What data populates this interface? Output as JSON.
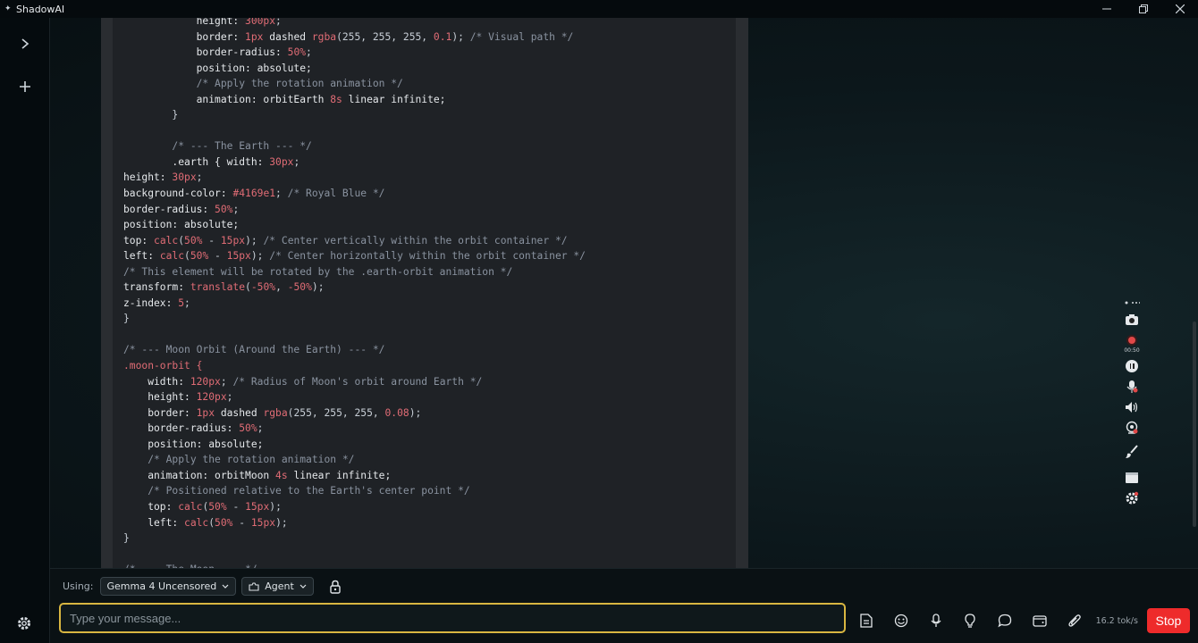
{
  "window": {
    "title": "ShadowAI"
  },
  "code_lines": [
    [
      {
        "t": "            height: ",
        "c": "k"
      },
      {
        "t": "300px",
        "c": "n"
      },
      {
        "t": ";",
        "c": "p"
      }
    ],
    [
      {
        "t": "            border: ",
        "c": "k"
      },
      {
        "t": "1px",
        "c": "n"
      },
      {
        "t": " dashed ",
        "c": "k"
      },
      {
        "t": "rgba",
        "c": "n"
      },
      {
        "t": "(255, 255, 255, ",
        "c": "p"
      },
      {
        "t": "0.1",
        "c": "n"
      },
      {
        "t": "); ",
        "c": "p"
      },
      {
        "t": "/* Visual path */",
        "c": "c"
      }
    ],
    [
      {
        "t": "            border-radius: ",
        "c": "k"
      },
      {
        "t": "50%",
        "c": "n"
      },
      {
        "t": ";",
        "c": "p"
      }
    ],
    [
      {
        "t": "            position: absolute;",
        "c": "k"
      }
    ],
    [
      {
        "t": "            /* Apply the rotation animation */",
        "c": "c"
      }
    ],
    [
      {
        "t": "            animation: orbitEarth ",
        "c": "k"
      },
      {
        "t": "8s",
        "c": "n"
      },
      {
        "t": " linear infinite;",
        "c": "k"
      }
    ],
    [
      {
        "t": "        }",
        "c": "p"
      }
    ],
    [
      {
        "t": "",
        "c": "p"
      }
    ],
    [
      {
        "t": "        /* --- The Earth --- */",
        "c": "c"
      }
    ],
    [
      {
        "t": "        .earth { width: ",
        "c": "k"
      },
      {
        "t": "30px",
        "c": "n"
      },
      {
        "t": ";",
        "c": "p"
      }
    ],
    [
      {
        "t": "height: ",
        "c": "k"
      },
      {
        "t": "30px",
        "c": "n"
      },
      {
        "t": ";",
        "c": "p"
      }
    ],
    [
      {
        "t": "background-color: ",
        "c": "k"
      },
      {
        "t": "#4169e1",
        "c": "n"
      },
      {
        "t": "; ",
        "c": "p"
      },
      {
        "t": "/* Royal Blue */",
        "c": "c"
      }
    ],
    [
      {
        "t": "border-radius: ",
        "c": "k"
      },
      {
        "t": "50%",
        "c": "n"
      },
      {
        "t": ";",
        "c": "p"
      }
    ],
    [
      {
        "t": "position: absolute;",
        "c": "k"
      }
    ],
    [
      {
        "t": "top: ",
        "c": "k"
      },
      {
        "t": "calc",
        "c": "n"
      },
      {
        "t": "(",
        "c": "p"
      },
      {
        "t": "50%",
        "c": "n"
      },
      {
        "t": " - ",
        "c": "p"
      },
      {
        "t": "15px",
        "c": "n"
      },
      {
        "t": "); ",
        "c": "p"
      },
      {
        "t": "/* Center vertically within the orbit container */",
        "c": "c"
      }
    ],
    [
      {
        "t": "left: ",
        "c": "k"
      },
      {
        "t": "calc",
        "c": "n"
      },
      {
        "t": "(",
        "c": "p"
      },
      {
        "t": "50%",
        "c": "n"
      },
      {
        "t": " - ",
        "c": "p"
      },
      {
        "t": "15px",
        "c": "n"
      },
      {
        "t": "); ",
        "c": "p"
      },
      {
        "t": "/* Center horizontally within the orbit container */",
        "c": "c"
      }
    ],
    [
      {
        "t": "/* This element will be rotated by the .earth-orbit animation */",
        "c": "c"
      }
    ],
    [
      {
        "t": "transform: ",
        "c": "k"
      },
      {
        "t": "translate",
        "c": "n"
      },
      {
        "t": "(",
        "c": "p"
      },
      {
        "t": "-50%",
        "c": "n"
      },
      {
        "t": ", ",
        "c": "p"
      },
      {
        "t": "-50%",
        "c": "n"
      },
      {
        "t": ");",
        "c": "p"
      }
    ],
    [
      {
        "t": "z-index: ",
        "c": "k"
      },
      {
        "t": "5",
        "c": "n"
      },
      {
        "t": ";",
        "c": "p"
      }
    ],
    [
      {
        "t": "}",
        "c": "p"
      }
    ],
    [
      {
        "t": "",
        "c": "p"
      }
    ],
    [
      {
        "t": "/* --- Moon Orbit (Around the Earth) --- */",
        "c": "c"
      }
    ],
    [
      {
        "t": ".moon-orbit {",
        "c": "n"
      }
    ],
    [
      {
        "t": "    width: ",
        "c": "k"
      },
      {
        "t": "120px",
        "c": "n"
      },
      {
        "t": "; ",
        "c": "p"
      },
      {
        "t": "/* Radius of Moon's orbit around Earth */",
        "c": "c"
      }
    ],
    [
      {
        "t": "    height: ",
        "c": "k"
      },
      {
        "t": "120px",
        "c": "n"
      },
      {
        "t": ";",
        "c": "p"
      }
    ],
    [
      {
        "t": "    border: ",
        "c": "k"
      },
      {
        "t": "1px",
        "c": "n"
      },
      {
        "t": " dashed ",
        "c": "k"
      },
      {
        "t": "rgba",
        "c": "n"
      },
      {
        "t": "(255, 255, 255, ",
        "c": "p"
      },
      {
        "t": "0.08",
        "c": "n"
      },
      {
        "t": ");",
        "c": "p"
      }
    ],
    [
      {
        "t": "    border-radius: ",
        "c": "k"
      },
      {
        "t": "50%",
        "c": "n"
      },
      {
        "t": ";",
        "c": "p"
      }
    ],
    [
      {
        "t": "    position: absolute;",
        "c": "k"
      }
    ],
    [
      {
        "t": "    /* Apply the rotation animation */",
        "c": "c"
      }
    ],
    [
      {
        "t": "    animation: orbitMoon ",
        "c": "k"
      },
      {
        "t": "4s",
        "c": "n"
      },
      {
        "t": " linear infinite;",
        "c": "k"
      }
    ],
    [
      {
        "t": "    /* Positioned relative to the Earth's center point */",
        "c": "c"
      }
    ],
    [
      {
        "t": "    top: ",
        "c": "k"
      },
      {
        "t": "calc",
        "c": "n"
      },
      {
        "t": "(",
        "c": "p"
      },
      {
        "t": "50%",
        "c": "n"
      },
      {
        "t": " - ",
        "c": "p"
      },
      {
        "t": "15px",
        "c": "n"
      },
      {
        "t": ");",
        "c": "p"
      }
    ],
    [
      {
        "t": "    left: ",
        "c": "k"
      },
      {
        "t": "calc",
        "c": "n"
      },
      {
        "t": "(",
        "c": "p"
      },
      {
        "t": "50%",
        "c": "n"
      },
      {
        "t": " - ",
        "c": "p"
      },
      {
        "t": "15px",
        "c": "n"
      },
      {
        "t": ");",
        "c": "p"
      }
    ],
    [
      {
        "t": "}",
        "c": "p"
      }
    ],
    [
      {
        "t": "",
        "c": "p"
      }
    ],
    [
      {
        "t": "/* --- The Moon --- */",
        "c": "c"
      }
    ]
  ],
  "toolbar": {
    "using_label": "Using:",
    "model": "Gemma 4 Uncensored",
    "mode": "Agent"
  },
  "recorder": {
    "timer": "00:50"
  },
  "input": {
    "placeholder": "Type your message..."
  },
  "status": {
    "speed": "16.2 tok/s"
  },
  "buttons": {
    "stop": "Stop"
  },
  "colors": {
    "accent_border": "#d9b641",
    "stop": "#ee2b2b"
  }
}
